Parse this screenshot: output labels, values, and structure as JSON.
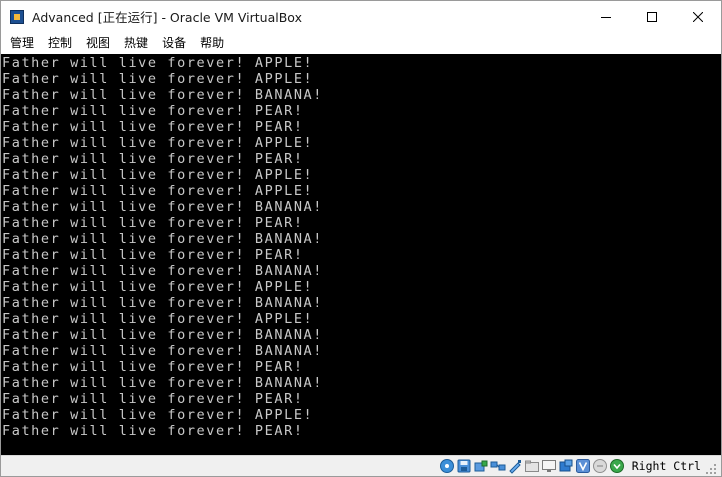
{
  "window": {
    "title": "Advanced [正在运行] - Oracle VM VirtualBox"
  },
  "menu": {
    "items": [
      {
        "label": "管理"
      },
      {
        "label": "控制"
      },
      {
        "label": "视图"
      },
      {
        "label": "热键"
      },
      {
        "label": "设备"
      },
      {
        "label": "帮助"
      }
    ]
  },
  "console": {
    "lines": [
      "Father will live forever! APPLE!",
      "Father will live forever! APPLE!",
      "Father will live forever! BANANA!",
      "Father will live forever! PEAR!",
      "Father will live forever! PEAR!",
      "Father will live forever! APPLE!",
      "Father will live forever! PEAR!",
      "Father will live forever! APPLE!",
      "Father will live forever! APPLE!",
      "Father will live forever! BANANA!",
      "Father will live forever! PEAR!",
      "Father will live forever! BANANA!",
      "Father will live forever! PEAR!",
      "Father will live forever! BANANA!",
      "Father will live forever! APPLE!",
      "Father will live forever! BANANA!",
      "Father will live forever! APPLE!",
      "Father will live forever! BANANA!",
      "Father will live forever! BANANA!",
      "Father will live forever! PEAR!",
      "Father will live forever! BANANA!",
      "Father will live forever! PEAR!",
      "Father will live forever! APPLE!",
      "Father will live forever! PEAR!"
    ]
  },
  "statusbar": {
    "host_key_label": "Right Ctrl",
    "icons": [
      "hard-disk-icon",
      "optical-drive-icon",
      "audio-icon",
      "network-icon",
      "usb-icon",
      "shared-folders-icon",
      "display-icon",
      "video-capture-icon",
      "virtualization-icon",
      "mouse-integration-icon",
      "keyboard-icon"
    ]
  }
}
